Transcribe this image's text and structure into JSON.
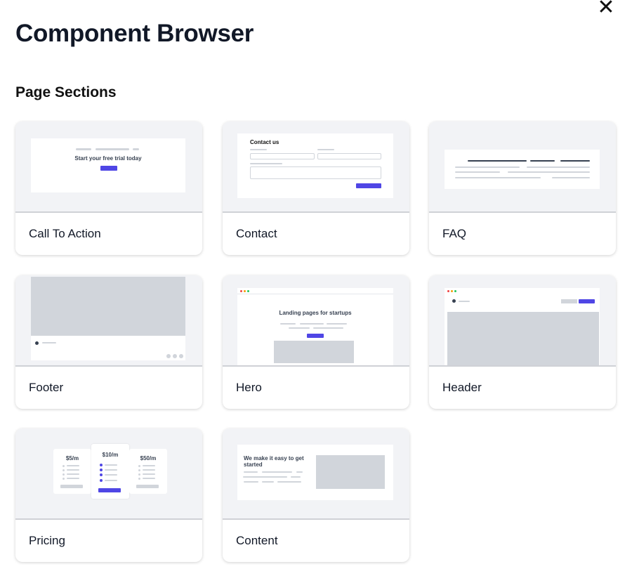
{
  "header": {
    "title": "Component Browser",
    "close_icon": "close-icon"
  },
  "section": {
    "title": "Page Sections"
  },
  "cards": [
    {
      "label": "Call To Action",
      "preview_text": "Start your free trial today"
    },
    {
      "label": "Contact",
      "preview_text": "Contact us"
    },
    {
      "label": "FAQ"
    },
    {
      "label": "Footer"
    },
    {
      "label": "Hero",
      "preview_text": "Landing pages for startups"
    },
    {
      "label": "Header"
    },
    {
      "label": "Pricing",
      "prices": [
        "$5/m",
        "$10/m",
        "$50/m"
      ]
    },
    {
      "label": "Content",
      "preview_text": "We make it easy to get started"
    }
  ],
  "colors": {
    "accent": "#4f46e5",
    "thumb_bg": "#f2f3f6",
    "placeholder": "#d1d5db"
  }
}
